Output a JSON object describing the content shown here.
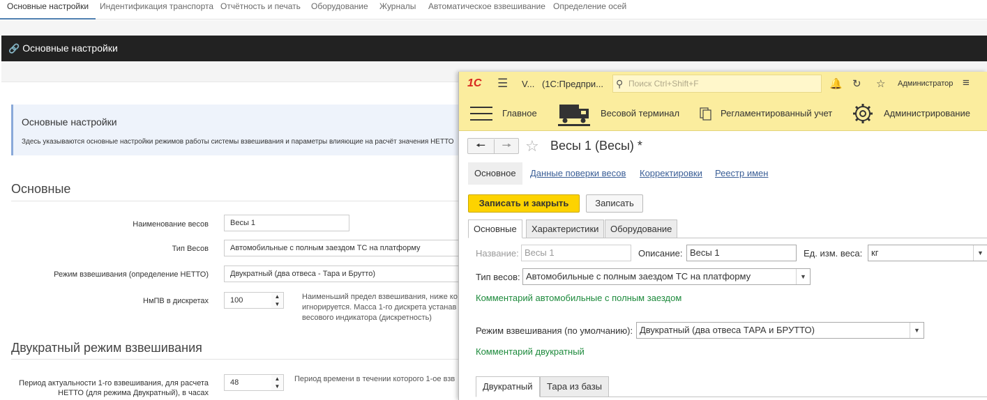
{
  "web": {
    "tabs": [
      "Основные настройки",
      "Индентификация транспорта",
      "Отчётность и печать",
      "Оборудование",
      "Журналы",
      "Автоматическое взвешивание",
      "Определение осей"
    ],
    "header_title": "Основные настройки",
    "info_title": "Основные настройки",
    "info_desc": "Здесь указываются основные настройки режимов работы системы взвешивания и параметры влияющие на расчёт значения НЕТТО",
    "section_main": "Основные",
    "section_double": "Двукратный режим взвешивания",
    "fields": {
      "name_label": "Наименование весов",
      "name_value": "Весы 1",
      "type_label": "Тип Весов",
      "type_value": "Автомобильные с полным заездом ТС на платформу",
      "mode_label": "Режим взвешивания (определение НЕТТО)",
      "mode_value": "Двукратный (два отвеса - Тара и Брутто)",
      "nmpv_label": "НмПВ в дискретах",
      "nmpv_value": "100",
      "nmpv_hint_1": "Наименьший предел взвешивания, ниже ко",
      "nmpv_hint_2": "игнорируется. Масса 1-го дискрета устанав",
      "nmpv_hint_3": "весового индикатора (дискретность)",
      "period_label_1": "Период актуальности 1-го взвешивания, для расчета",
      "period_label_2": "НЕТТО (для режима Двукратный), в часах",
      "period_value": "48",
      "period_hint": "Период времени в течении которого 1-ое взв"
    }
  },
  "onec": {
    "app_title_short": "V...",
    "app_title": "(1С:Предпри...",
    "search_placeholder": "Поиск Ctrl+Shift+F",
    "user": "Администратор",
    "sections": [
      "Главное",
      "Весовой терминал",
      "Регламентированный учет",
      "Администрирование"
    ],
    "form_title": "Весы 1 (Весы) *",
    "form_tabs": [
      "Основное",
      "Данные поверки весов",
      "Корректировки",
      "Реестр имен"
    ],
    "btn_save_close": "Записать и закрыть",
    "btn_save": "Записать",
    "page_tabs": [
      "Основные",
      "Характеристики",
      "Оборудование"
    ],
    "name_label": "Название:",
    "name_value": "Весы 1",
    "desc_label": "Описание:",
    "desc_value": "Весы 1",
    "unit_label": "Ед. изм. веса:",
    "unit_value": "кг",
    "type_label": "Тип весов:",
    "type_value": "Автомобильные с полным заездом ТС на платформу",
    "type_comment": "Комментарий автомобильные с полным заездом",
    "mode_label": "Режим взвешивания (по умолчанию):",
    "mode_value": "Двукратный (два отвеса ТАРА и БРУТТО)",
    "mode_comment": "Комментарий двукратный",
    "bottom_tabs": [
      "Двукратный",
      "Тара из базы"
    ]
  }
}
